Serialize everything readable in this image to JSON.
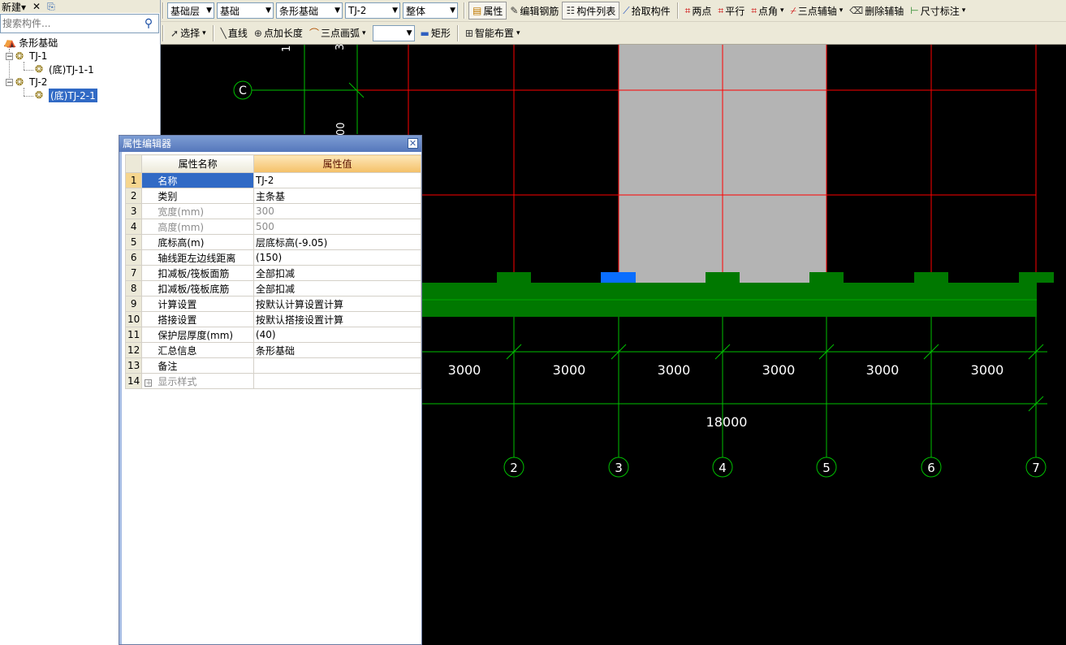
{
  "left_toolbar": {
    "new_label": "新建",
    "new_dropdown": "▾",
    "delete_icon": "✕",
    "copy_icon": "⎘"
  },
  "search": {
    "placeholder": "搜索构件..."
  },
  "tree": {
    "root": "条形基础",
    "nodes": [
      {
        "label": "TJ-1",
        "expander": "⊟",
        "children": [
          {
            "label": "(底)TJ-1-1"
          }
        ]
      },
      {
        "label": "TJ-2",
        "expander": "⊟",
        "children": [
          {
            "label": "(底)TJ-2-1",
            "selected": true
          }
        ]
      }
    ]
  },
  "toolbar1": {
    "combos": [
      {
        "value": "基础层"
      },
      {
        "value": "基础"
      },
      {
        "value": "条形基础"
      },
      {
        "value": "TJ-2"
      },
      {
        "value": "整体"
      }
    ],
    "buttons": [
      {
        "label": "属性",
        "icon": "properties-icon",
        "pressed": true
      },
      {
        "label": "编辑钢筋",
        "icon": "edit-rebar-icon"
      },
      {
        "label": "构件列表",
        "icon": "list-icon",
        "pressed": true
      },
      {
        "label": "拾取构件",
        "icon": "pick-icon"
      },
      {
        "label": "两点",
        "icon": "two-point-axis-icon"
      },
      {
        "label": "平行",
        "icon": "parallel-axis-icon"
      },
      {
        "label": "点角",
        "icon": "point-angle-icon",
        "dropdown": true
      },
      {
        "label": "三点辅轴",
        "icon": "three-point-axis-icon",
        "dropdown": true
      },
      {
        "label": "删除辅轴",
        "icon": "delete-axis-icon"
      },
      {
        "label": "尺寸标注",
        "icon": "dimension-icon",
        "dropdown": true
      }
    ]
  },
  "toolbar2": {
    "buttons": [
      {
        "label": "选择",
        "icon": "cursor-icon",
        "dropdown": true
      },
      {
        "label": "直线",
        "icon": "line-icon"
      },
      {
        "label": "点加长度",
        "icon": "point-length-icon"
      },
      {
        "label": "三点画弧",
        "icon": "arc-icon",
        "dropdown": true
      }
    ],
    "blank_combo": "",
    "buttons2": [
      {
        "label": "矩形",
        "icon": "rectangle-icon"
      },
      {
        "label": "智能布置",
        "icon": "smart-layout-icon",
        "dropdown": true
      }
    ]
  },
  "canvas": {
    "axis_labels": {
      "row_c": "C",
      "cols": [
        "2",
        "3",
        "4",
        "5",
        "6",
        "7"
      ]
    },
    "partial_texts": [
      "1",
      "3",
      "00"
    ],
    "dimensions": [
      "3000",
      "3000",
      "3000",
      "3000",
      "3000",
      "3000"
    ],
    "total_dimension": "18000",
    "colors": {
      "grid": "#ff0000",
      "axis": "#00c000",
      "foundation": "#007800",
      "column": "#b4b4b4",
      "selected": "#0a6eff",
      "text": "#ffffff"
    }
  },
  "property_editor": {
    "title": "属性编辑器",
    "close_icon": "✕",
    "headers": {
      "name": "属性名称",
      "value": "属性值"
    },
    "rows": [
      {
        "num": "1",
        "name": "名称",
        "value": "TJ-2",
        "selected": true
      },
      {
        "num": "2",
        "name": "类别",
        "value": "主条基"
      },
      {
        "num": "3",
        "name": "宽度(mm)",
        "value": "300",
        "grey": true
      },
      {
        "num": "4",
        "name": "高度(mm)",
        "value": "500",
        "grey": true
      },
      {
        "num": "5",
        "name": "底标高(m)",
        "value": "层底标高(-9.05)"
      },
      {
        "num": "6",
        "name": "轴线距左边线距离",
        "value": "(150)"
      },
      {
        "num": "7",
        "name": "扣减板/筏板面筋",
        "value": "全部扣减"
      },
      {
        "num": "8",
        "name": "扣减板/筏板底筋",
        "value": "全部扣减"
      },
      {
        "num": "9",
        "name": "计算设置",
        "value": "按默认计算设置计算"
      },
      {
        "num": "10",
        "name": "搭接设置",
        "value": "按默认搭接设置计算"
      },
      {
        "num": "11",
        "name": "保护层厚度(mm)",
        "value": "(40)"
      },
      {
        "num": "12",
        "name": "汇总信息",
        "value": "条形基础"
      },
      {
        "num": "13",
        "name": "备注",
        "value": ""
      },
      {
        "num": "14",
        "name": "显示样式",
        "value": "",
        "expander": "+",
        "grey": true
      }
    ]
  }
}
